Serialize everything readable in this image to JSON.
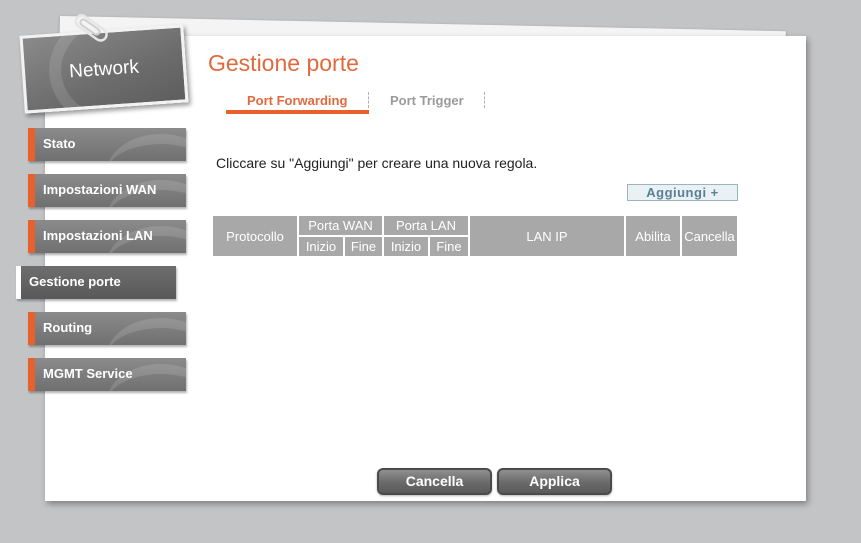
{
  "network_card": {
    "label": "Network"
  },
  "sidebar": {
    "items": [
      {
        "label": "Stato",
        "active": false
      },
      {
        "label": "Impostazioni WAN",
        "active": false
      },
      {
        "label": "Impostazioni LAN",
        "active": false
      },
      {
        "label": "Gestione porte",
        "active": true
      },
      {
        "label": "Routing",
        "active": false
      },
      {
        "label": "MGMT Service",
        "active": false
      }
    ]
  },
  "page": {
    "title": "Gestione porte"
  },
  "tabs": [
    {
      "label": "Port Forwarding",
      "active": true
    },
    {
      "label": "Port Trigger",
      "active": false
    }
  ],
  "main": {
    "hint": "Cliccare su \"Aggiungi\" per creare una nuova regola.",
    "add_label": "Aggiungi +"
  },
  "table": {
    "headers": {
      "protocol": "Protocollo",
      "wan_port": "Porta WAN",
      "lan_port": "Porta LAN",
      "start": "Inizio",
      "end": "Fine",
      "lan_ip": "LAN IP",
      "enable": "Abilita",
      "delete": "Cancella"
    },
    "rows": []
  },
  "footer": {
    "cancel_label": "Cancella",
    "apply_label": "Applica"
  },
  "colors": {
    "accent": "#e8612c",
    "title": "#e06a3e",
    "header_bg": "#a8a8a8",
    "background": "#c3c4c6"
  }
}
